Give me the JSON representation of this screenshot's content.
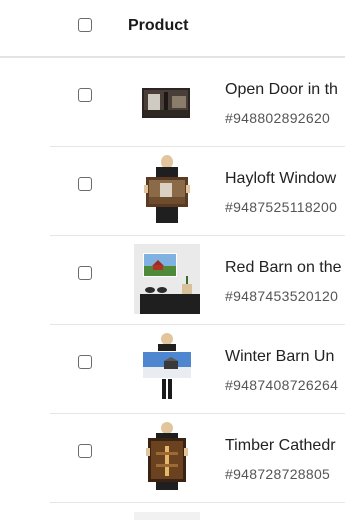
{
  "header": {
    "product_label": "Product"
  },
  "rows": [
    {
      "title": "Open Door in th",
      "sku": "#948802892620",
      "thumb_icon": "barn-interior-photo-icon"
    },
    {
      "title": "Hayloft Window",
      "sku": "#9487525118200",
      "thumb_icon": "poster-held-hayloft-icon"
    },
    {
      "title": "Red Barn on the",
      "sku": "#9487453520120",
      "thumb_icon": "framed-red-barn-wall-icon"
    },
    {
      "title": "Winter Barn Un",
      "sku": "#9487408726264",
      "thumb_icon": "poster-held-winter-barn-icon"
    },
    {
      "title": "Timber Cathedr",
      "sku": "#948728728805",
      "thumb_icon": "poster-held-timber-icon"
    }
  ]
}
